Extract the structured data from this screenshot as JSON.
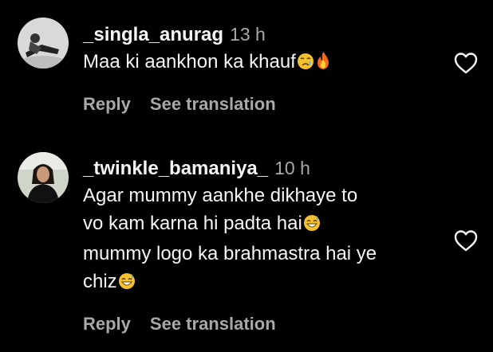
{
  "comments": [
    {
      "username": "_singla_anurag",
      "time": "13 h",
      "lines": [
        "Maa ki aankhon ka khauf"
      ],
      "emojis": [
        "crying-face-emoji",
        "fire-emoji"
      ],
      "reply_label": "Reply",
      "translate_label": "See translation"
    },
    {
      "username": "_twinkle_bamaniya_",
      "time": "10 h",
      "lines": [
        "Agar mummy aankhe dikhaye to",
        "vo kam karna hi padta hai",
        "mummy logo ka brahmastra hai ye",
        "chiz"
      ],
      "emojis": [
        "grinning-sweat-emoji",
        "grinning-sweat-emoji"
      ],
      "reply_label": "Reply",
      "translate_label": "See translation"
    }
  ],
  "colors": {
    "background": "#000000",
    "primary_text": "#f5f5f5",
    "secondary_text": "#a8a8a8"
  }
}
